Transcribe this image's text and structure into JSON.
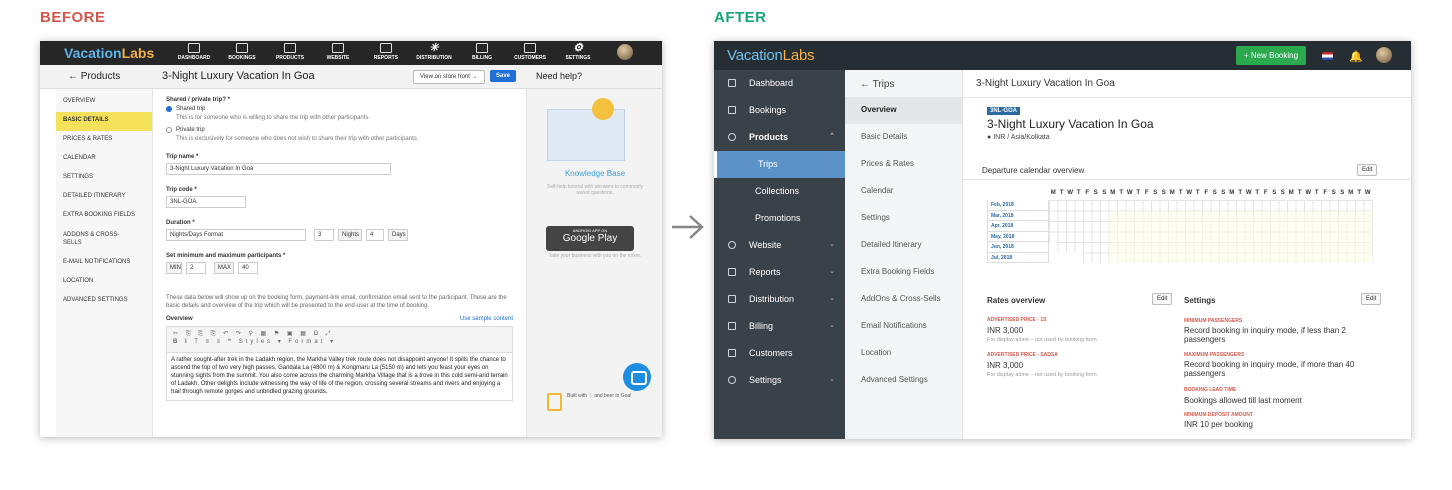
{
  "labels": {
    "before": "BEFORE",
    "after": "AFTER"
  },
  "before": {
    "logo": {
      "part1": "Vacation",
      "part2": "Labs"
    },
    "nav": [
      "DASHBOARD",
      "BOOKINGS",
      "PRODUCTS",
      "WEBSITE",
      "REPORTS",
      "DISTRIBUTION",
      "BILLING",
      "CUSTOMERS",
      "SETTINGS"
    ],
    "header": {
      "back": "← Products",
      "title": "3-Night Luxury Vacation In Goa",
      "store": "View on store front →",
      "save": "Save",
      "help": "Need help?"
    },
    "sidebar": [
      "OVERVIEW",
      "BASIC DETAILS",
      "PRICES & RATES",
      "CALENDAR",
      "SETTINGS",
      "DETAILED ITINERARY",
      "EXTRA BOOKING FIELDS",
      "ADDONS & CROSS-SELLS",
      "E-MAIL NOTIFICATIONS",
      "LOCATION",
      "ADVANCED SETTINGS"
    ],
    "form": {
      "share_q": "Shared / private trip? *",
      "shared": "Shared trip",
      "shared_sub": "This is for someone who is willing to share the trip with other participants.",
      "private": "Private trip",
      "private_sub": "This is exclusively for someone who does not wish to share their trip with other participants.",
      "name_l": "Trip name *",
      "name_v": "3-Night Luxury Vacation In Goa",
      "code_l": "Trip code *",
      "code_v": "3NL-GOA",
      "dur_l": "Duration *",
      "dur_fmt": "Nights/Days Format",
      "nights": "3",
      "nights_l": "Nights",
      "days": "4",
      "days_l": "Days",
      "part_l": "Set minimum and maximum participants *",
      "min_l": "MIN",
      "min_v": "2",
      "max_l": "MAX",
      "max_v": "40",
      "desc": "These data below will show up on the booking form, payment-link email, confirmation email sent to the participant. These are the basic details and overview of the trip which will be presented to the end-user at the time of booking.",
      "ov_l": "Overview",
      "ov_link": "Use sample content",
      "styles": "Styles",
      "format": "Format",
      "ov_text": "A rather sought-after trek in the Ladakh region, the Markha Valley trek route does not disappoint anyone! It spills the chance to ascend the top of two very high passes, Gandala La (4800 m) & Kongmaru La (5150 m) and lets you feast your eyes on stunning sights from the summit. You also come across the charming Markha Village that is a trove in this cold semi-arid terrain of Ladakh. Other delights include witnessing the way of life of the region, crossing several streams and rivers and enjoying a trail through remote gorges and unbridled grazing grounds."
    },
    "help": {
      "kb": "Knowledge Base",
      "kb_sub": "Self-help tutorial with answers to commonly asked questions.",
      "gp_small": "ANDROID APP ON",
      "gp": "Google Play",
      "gp_sub": "Take your business with you on the move.",
      "beer": "Built with ♡ and beer in Goa!"
    }
  },
  "after": {
    "logo": {
      "part1": "Vacation",
      "part2": "Labs"
    },
    "new_booking": "+ New Booking",
    "sidebar": [
      "Dashboard",
      "Bookings",
      "Products",
      "Trips",
      "Collections",
      "Promotions",
      "Website",
      "Reports",
      "Distribution",
      "Billing",
      "Customers",
      "Settings"
    ],
    "sub": {
      "back": "← Trips",
      "items": [
        "Overview",
        "Basic Details",
        "Prices & Rates",
        "Calendar",
        "Settings",
        "Detailed Itinerary",
        "Extra Booking Fields",
        "AddOns & Cross-Sells",
        "Email Notifications",
        "Location",
        "Advanced Settings"
      ]
    },
    "page_title": "3-Night Luxury Vacation In Goa",
    "code": "3NL-GOA",
    "name": "3-Night Luxury Vacation In Goa",
    "currency": "INR / Asia/Kolkata",
    "calendar": {
      "title": "Departure calendar overview",
      "edit": "Edit",
      "days": [
        "M",
        "T",
        "W",
        "T",
        "F",
        "S",
        "S",
        "M",
        "T",
        "W",
        "T",
        "F",
        "S",
        "S",
        "M",
        "T",
        "W",
        "T",
        "F",
        "S",
        "S",
        "M",
        "T",
        "W",
        "T",
        "F",
        "S",
        "S",
        "M",
        "T",
        "W",
        "T",
        "F",
        "S",
        "S",
        "M",
        "T",
        "W"
      ],
      "months": [
        "Feb, 2018",
        "Mar, 2018",
        "Apr, 2018",
        "May, 2018",
        "Jun, 2018",
        "Jul, 2018"
      ]
    },
    "rates": {
      "title": "Rates overview",
      "edit": "Edit",
      "p1_l": "ADVERTISED PRICE - 1S",
      "p1_v": "INR 3,000",
      "p1_n": "For display alone – not used by booking form",
      "p2_l": "ADVERTISED PRICE - SADSA",
      "p2_v": "INR 3,000",
      "p2_n": "For display alone – not used by booking form"
    },
    "settings": {
      "title": "Settings",
      "edit": "Edit",
      "s1_l": "MINIMUM PASSENGERS",
      "s1_v": "Record booking in inquiry mode, if less than 2 passengers",
      "s2_l": "MAXIMUM PASSENGERS",
      "s2_v": "Record booking in inquiry mode, if more than 40 passengers",
      "s3_l": "BOOKING LEAD TIME",
      "s3_v": "Bookings allowed till last moment",
      "s4_l": "MINIMUM DEPOSIT AMOUNT",
      "s4_v": "INR 10 per booking"
    }
  }
}
